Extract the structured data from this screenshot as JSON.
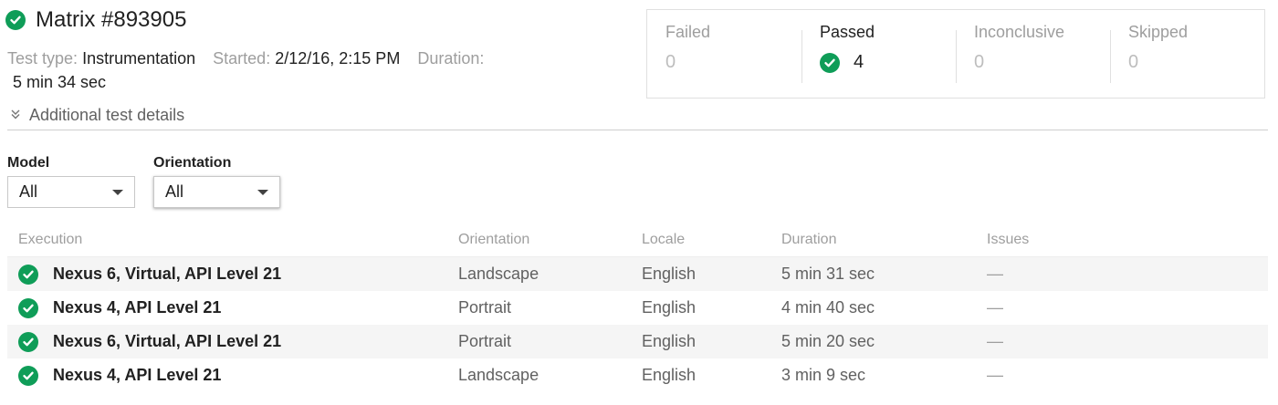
{
  "header": {
    "title": "Matrix #893905",
    "test_type_label": "Test type:",
    "test_type_value": "Instrumentation",
    "started_label": "Started:",
    "started_value": "2/12/16, 2:15 PM",
    "duration_label": "Duration:",
    "duration_value": "5 min 34 sec",
    "details_toggle": "Additional test details"
  },
  "summary": [
    {
      "label": "Failed",
      "value": "0"
    },
    {
      "label": "Passed",
      "value": "4"
    },
    {
      "label": "Inconclusive",
      "value": "0"
    },
    {
      "label": "Skipped",
      "value": "0"
    }
  ],
  "filters": {
    "model_label": "Model",
    "model_value": "All",
    "orientation_label": "Orientation",
    "orientation_value": "All"
  },
  "table": {
    "columns": [
      "Execution",
      "Orientation",
      "Locale",
      "Duration",
      "Issues"
    ],
    "rows": [
      {
        "execution": "Nexus 6, Virtual, API Level 21",
        "orientation": "Landscape",
        "locale": "English",
        "duration": "5 min 31 sec",
        "issues": "—"
      },
      {
        "execution": "Nexus 4, API Level 21",
        "orientation": "Portrait",
        "locale": "English",
        "duration": "4 min 40 sec",
        "issues": "—"
      },
      {
        "execution": "Nexus 6, Virtual, API Level 21",
        "orientation": "Portrait",
        "locale": "English",
        "duration": "5 min 20 sec",
        "issues": "—"
      },
      {
        "execution": "Nexus 4, API Level 21",
        "orientation": "Landscape",
        "locale": "English",
        "duration": "3 min 9 sec",
        "issues": "—"
      }
    ]
  },
  "colors": {
    "success": "#0f9d58",
    "muted_text": "#9e9e9e",
    "row_alt": "#f5f5f5"
  },
  "icons": {
    "status": "check-circle-icon",
    "expand": "double-chevron-down-icon",
    "dropdown": "caret-down-icon"
  }
}
